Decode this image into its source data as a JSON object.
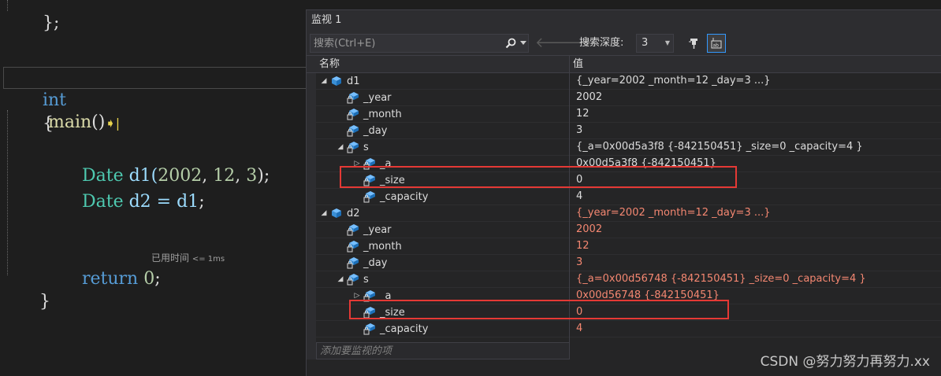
{
  "editor": {
    "top_fragment": "};",
    "lines": {
      "main_kw": "int",
      "main_name": "main",
      "main_parens": "()",
      "open_brace": "{",
      "d1_type": "Date",
      "d1_decl": "d1(",
      "d1_arg1": "2002",
      "d1_sep1": ", ",
      "d1_arg2": "12",
      "d1_sep2": ", ",
      "d1_arg3": "3",
      "d1_end": ");",
      "d2_type": "Date",
      "d2_decl": "d2 = ",
      "d2_src": "d1",
      "d2_end": ";",
      "ret_kw": "return",
      "ret_val": "0",
      "ret_end": ";",
      "close_brace": "}"
    },
    "perf_tip_label": "已用时间",
    "perf_tip_value": "<= 1ms"
  },
  "watch": {
    "title": "监视 1",
    "search_placeholder": "搜索(Ctrl+E)",
    "depth_label": "搜索深度:",
    "depth_value": "3",
    "columns": {
      "name": "名称",
      "value": "值"
    },
    "rows": [
      {
        "name": "d1",
        "value": "{_year=2002 _month=12 _day=3 ...}",
        "changed": false
      },
      {
        "name": "_year",
        "value": "2002",
        "changed": false
      },
      {
        "name": "_month",
        "value": "12",
        "changed": false
      },
      {
        "name": "_day",
        "value": "3",
        "changed": false
      },
      {
        "name": "s",
        "value": "{_a=0x00d5a3f8 {-842150451} _size=0 _capacity=4 }",
        "changed": false
      },
      {
        "name": "_a",
        "value": "0x00d5a3f8 {-842150451}",
        "changed": false
      },
      {
        "name": "_size",
        "value": "0",
        "changed": false
      },
      {
        "name": "_capacity",
        "value": "4",
        "changed": false
      },
      {
        "name": "d2",
        "value": "{_year=2002 _month=12 _day=3 ...}",
        "changed": true
      },
      {
        "name": "_year",
        "value": "2002",
        "changed": true
      },
      {
        "name": "_month",
        "value": "12",
        "changed": true
      },
      {
        "name": "_day",
        "value": "3",
        "changed": true
      },
      {
        "name": "s",
        "value": "{_a=0x00d56748 {-842150451} _size=0 _capacity=4 }",
        "changed": true
      },
      {
        "name": "_a",
        "value": "0x00d56748 {-842150451}",
        "changed": true
      },
      {
        "name": "_size",
        "value": "0",
        "changed": true
      },
      {
        "name": "_capacity",
        "value": "4",
        "changed": true
      }
    ],
    "add_item_placeholder": "添加要监视的项"
  },
  "watermark": "CSDN @努力努力再努力.xx",
  "colors": {
    "changed_value": "#f48771",
    "highlight": "#e53935",
    "accent": "#3399ff"
  },
  "icons": {
    "search": "search-icon",
    "back": "arrow-left-icon",
    "forward": "arrow-right-icon",
    "pin": "pin-icon",
    "format": "format-hex-icon",
    "object": "object-cube-icon",
    "field": "field-lock-icon",
    "step": "current-statement-arrow-icon"
  }
}
